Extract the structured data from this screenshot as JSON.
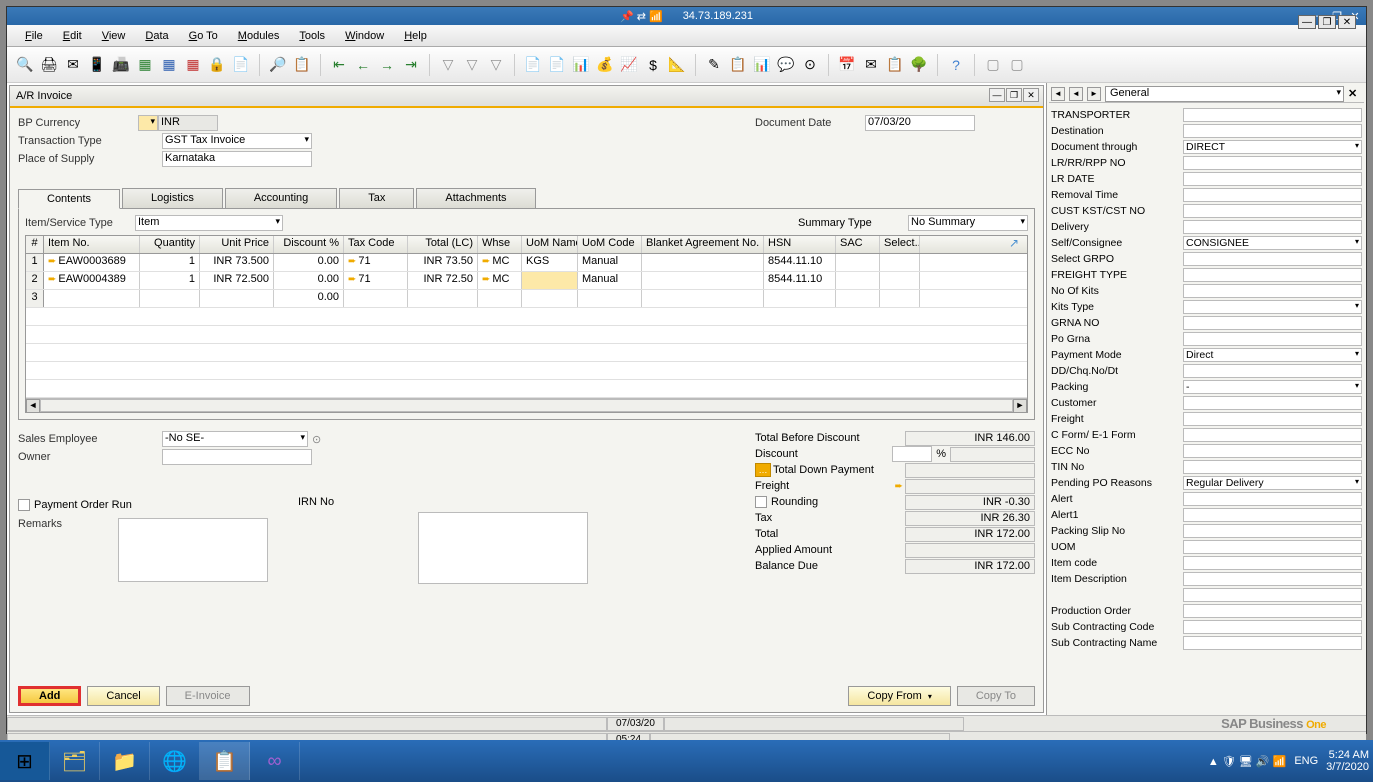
{
  "title_ip": "34.73.189.231",
  "menu": {
    "file": "File",
    "edit": "Edit",
    "view": "View",
    "data": "Data",
    "goto": "Go To",
    "modules": "Modules",
    "tools": "Tools",
    "window": "Window",
    "help": "Help"
  },
  "form": {
    "title": "A/R Invoice",
    "bp_currency_lbl": "BP Currency",
    "bp_currency_val": "INR",
    "transaction_type_lbl": "Transaction Type",
    "transaction_type_val": "GST Tax Invoice",
    "place_supply_lbl": "Place of Supply",
    "place_supply_val": "Karnataka",
    "doc_date_lbl": "Document Date",
    "doc_date_val": "07/03/20",
    "tabs": {
      "contents": "Contents",
      "logistics": "Logistics",
      "accounting": "Accounting",
      "tax": "Tax",
      "attachments": "Attachments"
    },
    "item_service_lbl": "Item/Service Type",
    "item_service_val": "Item",
    "summary_type_lbl": "Summary Type",
    "summary_type_val": "No Summary",
    "grid_headers": {
      "num": "#",
      "item": "Item No.",
      "qty": "Quantity",
      "price": "Unit Price",
      "disc": "Discount %",
      "tax": "Tax Code",
      "total": "Total (LC)",
      "whse": "Whse",
      "uomn": "UoM Name",
      "uomc": "UoM Code",
      "blanket": "Blanket Agreement No.",
      "hsn": "HSN",
      "sac": "SAC",
      "sel": "Select..."
    },
    "rows": [
      {
        "n": "1",
        "item": "EAW0003689",
        "qty": "1",
        "price": "INR 73.500",
        "disc": "0.00",
        "tax": "71",
        "total": "INR 73.50",
        "whse": "MC",
        "uomn": "KGS",
        "uomc": "Manual",
        "blanket": "",
        "hsn": "8544.11.10",
        "sac": ""
      },
      {
        "n": "2",
        "item": "EAW0004389",
        "qty": "1",
        "price": "INR 72.500",
        "disc": "0.00",
        "tax": "71",
        "total": "INR 72.50",
        "whse": "MC",
        "uomn": "",
        "uomc": "Manual",
        "blanket": "",
        "hsn": "8544.11.10",
        "sac": ""
      },
      {
        "n": "3",
        "item": "",
        "qty": "",
        "price": "",
        "disc": "0.00",
        "tax": "",
        "total": "",
        "whse": "",
        "uomn": "",
        "uomc": "",
        "blanket": "",
        "hsn": "",
        "sac": ""
      }
    ],
    "sales_emp_lbl": "Sales Employee",
    "sales_emp_val": "-No SE-",
    "owner_lbl": "Owner",
    "payment_order_lbl": "Payment Order Run",
    "remarks_lbl": "Remarks",
    "irn_lbl": "IRN No",
    "totals": {
      "before_lbl": "Total Before Discount",
      "before_val": "INR 146.00",
      "discount_lbl": "Discount",
      "discount_pct": "%",
      "downpay_lbl": "Total Down Payment",
      "freight_lbl": "Freight",
      "rounding_lbl": "Rounding",
      "rounding_val": "INR -0.30",
      "tax_lbl": "Tax",
      "tax_val": "INR 26.30",
      "total_lbl": "Total",
      "total_val": "INR 172.00",
      "applied_lbl": "Applied Amount",
      "balance_lbl": "Balance Due",
      "balance_val": "INR 172.00"
    },
    "buttons": {
      "add": "Add",
      "cancel": "Cancel",
      "einvoice": "E-Invoice",
      "copyfrom": "Copy From",
      "copyto": "Copy To"
    }
  },
  "side": {
    "dropdown": "General",
    "fields": [
      {
        "lbl": "TRANSPORTER",
        "val": "",
        "dd": false
      },
      {
        "lbl": "Destination",
        "val": "",
        "dd": false
      },
      {
        "lbl": "Document through",
        "val": "DIRECT",
        "dd": true
      },
      {
        "lbl": "LR/RR/RPP NO",
        "val": "",
        "dd": false
      },
      {
        "lbl": "LR DATE",
        "val": "",
        "dd": false
      },
      {
        "lbl": "Removal Time",
        "val": "",
        "dd": false
      },
      {
        "lbl": "CUST KST/CST NO",
        "val": "",
        "dd": false
      },
      {
        "lbl": "Delivery",
        "val": "",
        "dd": false
      },
      {
        "lbl": "Self/Consignee",
        "val": "CONSIGNEE",
        "dd": true
      },
      {
        "lbl": "Select GRPO",
        "val": "",
        "dd": false
      },
      {
        "lbl": "FREIGHT TYPE",
        "val": "",
        "dd": false
      },
      {
        "lbl": "No Of Kits",
        "val": "",
        "dd": false
      },
      {
        "lbl": "Kits Type",
        "val": "",
        "dd": true
      },
      {
        "lbl": "GRNA NO",
        "val": "",
        "dd": false
      },
      {
        "lbl": "Po Grna",
        "val": "",
        "dd": false
      },
      {
        "lbl": "Payment Mode",
        "val": "Direct",
        "dd": true
      },
      {
        "lbl": "DD/Chq.No/Dt",
        "val": "",
        "dd": false
      },
      {
        "lbl": "Packing",
        "val": "-",
        "dd": true
      },
      {
        "lbl": "Customer",
        "val": "",
        "dd": false
      },
      {
        "lbl": "Freight",
        "val": "",
        "dd": false
      },
      {
        "lbl": "C Form/ E-1 Form",
        "val": "",
        "dd": false
      },
      {
        "lbl": "ECC No",
        "val": "",
        "dd": false
      },
      {
        "lbl": "TIN No",
        "val": "",
        "dd": false
      },
      {
        "lbl": "Pending PO Reasons",
        "val": "Regular Delivery",
        "dd": true
      },
      {
        "lbl": "Alert",
        "val": "",
        "dd": false
      },
      {
        "lbl": "Alert1",
        "val": "",
        "dd": false
      },
      {
        "lbl": "Packing Slip No",
        "val": "",
        "dd": false
      },
      {
        "lbl": "UOM",
        "val": "",
        "dd": false
      },
      {
        "lbl": "Item code",
        "val": "",
        "dd": false
      },
      {
        "lbl": "Item Description",
        "val": "",
        "dd": false
      },
      {
        "lbl": "",
        "val": "",
        "dd": false
      },
      {
        "lbl": "Production Order",
        "val": "",
        "dd": false
      },
      {
        "lbl": "Sub Contracting Code",
        "val": "",
        "dd": false
      },
      {
        "lbl": "Sub Contracting Name",
        "val": "",
        "dd": false
      }
    ]
  },
  "status": {
    "date": "07/03/20",
    "time": "05:24"
  },
  "sap_brand": "SAP Business One",
  "tray": {
    "lang": "ENG",
    "time": "5:24 AM",
    "date": "3/7/2020"
  }
}
